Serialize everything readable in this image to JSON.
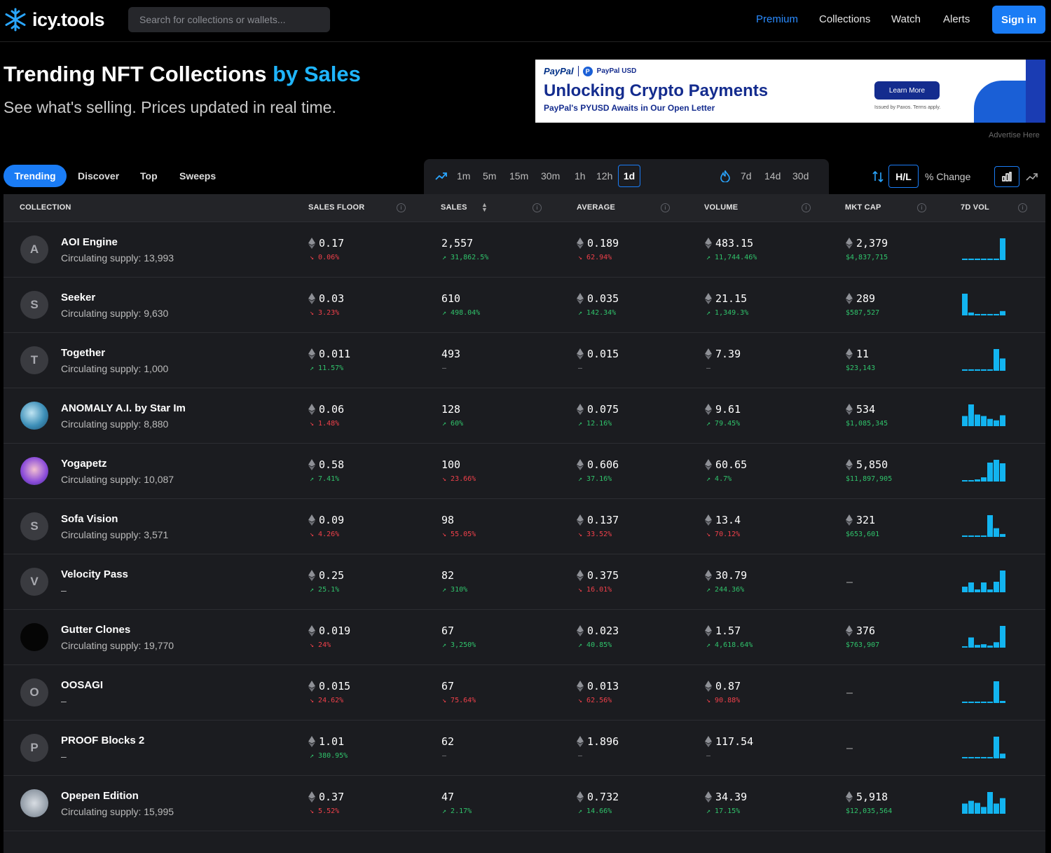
{
  "nav": {
    "brand": "icy.tools",
    "search_placeholder": "Search for collections or wallets...",
    "links": [
      "Premium",
      "Collections",
      "Watch",
      "Alerts"
    ],
    "signin": "Sign in",
    "accent": "#1a7cf5"
  },
  "hero": {
    "title": "Trending NFT Collections",
    "title_accent": "by Sales",
    "subtitle": "See what's selling. Prices updated in real time."
  },
  "ad": {
    "brand": "PayPal",
    "brand2": "PayPal USD",
    "headline": "Unlocking Crypto Payments",
    "sub": "PayPal's PYUSD Awaits in Our Open Letter",
    "button": "Learn More",
    "fine": "Issued by Paxos. Terms apply.",
    "advertise": "Advertise Here"
  },
  "tabs": [
    "Trending",
    "Discover",
    "Top",
    "Sweeps"
  ],
  "timeframes_short": [
    "1m",
    "5m",
    "15m",
    "30m",
    "1h",
    "12h",
    "1d"
  ],
  "timeframes_long": [
    "7d",
    "14d",
    "30d"
  ],
  "active_timeframe": "1d",
  "controls": {
    "hl": "H/L",
    "pct": "% Change"
  },
  "columns": [
    "COLLECTION",
    "SALES FLOOR",
    "SALES",
    "AVERAGE",
    "VOLUME",
    "MKT CAP",
    "7D VOL"
  ],
  "rows": [
    {
      "name": "AOI Engine",
      "supply": "Circulating supply: 13,993",
      "avatar": "A",
      "floor": "0.17",
      "floor_chg": "0.06%",
      "floor_dir": "down",
      "sales": "2,557",
      "sales_chg": "31,862.5%",
      "sales_dir": "up",
      "avg": "0.189",
      "avg_chg": "62.94%",
      "avg_dir": "down",
      "vol": "483.15",
      "vol_chg": "11,744.46%",
      "vol_dir": "up",
      "mcap": "2,379",
      "mcap_usd": "$4,837,715",
      "spark": [
        2,
        2,
        2,
        2,
        2,
        2,
        30
      ]
    },
    {
      "name": "Seeker",
      "supply": "Circulating supply: 9,630",
      "avatar": "S",
      "floor": "0.03",
      "floor_chg": "3.23%",
      "floor_dir": "down",
      "sales": "610",
      "sales_chg": "498.04%",
      "sales_dir": "up",
      "avg": "0.035",
      "avg_chg": "142.34%",
      "avg_dir": "up",
      "vol": "21.15",
      "vol_chg": "1,349.3%",
      "vol_dir": "up",
      "mcap": "289",
      "mcap_usd": "$587,527",
      "spark": [
        30,
        4,
        2,
        2,
        2,
        2,
        6
      ]
    },
    {
      "name": "Together",
      "supply": "Circulating supply: 1,000",
      "avatar": "T",
      "floor": "0.011",
      "floor_chg": "11.57%",
      "floor_dir": "up",
      "sales": "493",
      "sales_chg": "–",
      "sales_dir": "none",
      "avg": "0.015",
      "avg_chg": "–",
      "avg_dir": "none",
      "vol": "7.39",
      "vol_chg": "–",
      "vol_dir": "none",
      "mcap": "11",
      "mcap_usd": "$23,143",
      "spark": [
        2,
        2,
        2,
        2,
        2,
        30,
        17
      ]
    },
    {
      "name": "ANOMALY A.I. by Star Im",
      "supply": "Circulating supply: 8,880",
      "avatar": "",
      "floor": "0.06",
      "floor_chg": "1.48%",
      "floor_dir": "down",
      "sales": "128",
      "sales_chg": "60%",
      "sales_dir": "up",
      "avg": "0.075",
      "avg_chg": "12.16%",
      "avg_dir": "up",
      "vol": "9.61",
      "vol_chg": "79.45%",
      "vol_dir": "up",
      "mcap": "534",
      "mcap_usd": "$1,085,345",
      "spark": [
        14,
        30,
        16,
        14,
        10,
        8,
        15
      ]
    },
    {
      "name": "Yogapetz",
      "supply": "Circulating supply: 10,087",
      "avatar": "",
      "floor": "0.58",
      "floor_chg": "7.41%",
      "floor_dir": "up",
      "sales": "100",
      "sales_chg": "23.66%",
      "sales_dir": "down",
      "avg": "0.606",
      "avg_chg": "37.16%",
      "avg_dir": "up",
      "vol": "60.65",
      "vol_chg": "4.7%",
      "vol_dir": "up",
      "mcap": "5,850",
      "mcap_usd": "$11,897,905",
      "spark": [
        2,
        2,
        3,
        6,
        27,
        31,
        26
      ]
    },
    {
      "name": "Sofa Vision",
      "supply": "Circulating supply: 3,571",
      "avatar": "S",
      "floor": "0.09",
      "floor_chg": "4.26%",
      "floor_dir": "down",
      "sales": "98",
      "sales_chg": "55.05%",
      "sales_dir": "down",
      "avg": "0.137",
      "avg_chg": "33.52%",
      "avg_dir": "down",
      "vol": "13.4",
      "vol_chg": "70.12%",
      "vol_dir": "down",
      "mcap": "321",
      "mcap_usd": "$653,601",
      "spark": [
        2,
        2,
        2,
        2,
        30,
        12,
        4
      ]
    },
    {
      "name": "Velocity Pass",
      "supply": "–",
      "avatar": "V",
      "floor": "0.25",
      "floor_chg": "25.1%",
      "floor_dir": "up",
      "sales": "82",
      "sales_chg": "310%",
      "sales_dir": "up",
      "avg": "0.375",
      "avg_chg": "16.01%",
      "avg_dir": "down",
      "vol": "30.79",
      "vol_chg": "244.36%",
      "vol_dir": "up",
      "mcap": "–",
      "mcap_usd": "",
      "spark": [
        8,
        14,
        4,
        14,
        4,
        15,
        31
      ]
    },
    {
      "name": "Gutter Clones",
      "supply": "Circulating supply: 19,770",
      "avatar": "",
      "floor": "0.019",
      "floor_chg": "24%",
      "floor_dir": "down",
      "sales": "67",
      "sales_chg": "3,250%",
      "sales_dir": "up",
      "avg": "0.023",
      "avg_chg": "40.85%",
      "avg_dir": "up",
      "vol": "1.57",
      "vol_chg": "4,618.64%",
      "vol_dir": "up",
      "mcap": "376",
      "mcap_usd": "$763,907",
      "spark": [
        2,
        15,
        4,
        5,
        3,
        8,
        32
      ]
    },
    {
      "name": "OOSAGI",
      "supply": "–",
      "avatar": "O",
      "floor": "0.015",
      "floor_chg": "24.62%",
      "floor_dir": "down",
      "sales": "67",
      "sales_chg": "75.64%",
      "sales_dir": "down",
      "avg": "0.013",
      "avg_chg": "62.56%",
      "avg_dir": "down",
      "vol": "0.87",
      "vol_chg": "90.88%",
      "vol_dir": "down",
      "mcap": "–",
      "mcap_usd": "",
      "spark": [
        2,
        2,
        2,
        2,
        2,
        31,
        3
      ]
    },
    {
      "name": "PROOF Blocks 2",
      "supply": "–",
      "avatar": "P",
      "floor": "1.01",
      "floor_chg": "380.95%",
      "floor_dir": "up",
      "sales": "62",
      "sales_chg": "–",
      "sales_dir": "none",
      "avg": "1.896",
      "avg_chg": "–",
      "avg_dir": "none",
      "vol": "117.54",
      "vol_chg": "–",
      "vol_dir": "none",
      "mcap": "–",
      "mcap_usd": "",
      "spark": [
        2,
        2,
        2,
        2,
        2,
        32,
        7
      ]
    },
    {
      "name": "Opepen Edition",
      "supply": "Circulating supply: 15,995",
      "avatar": "",
      "floor": "0.37",
      "floor_chg": "5.52%",
      "floor_dir": "down",
      "sales": "47",
      "sales_chg": "2.17%",
      "sales_dir": "up",
      "avg": "0.732",
      "avg_chg": "14.66%",
      "avg_dir": "up",
      "vol": "34.39",
      "vol_chg": "17.15%",
      "vol_dir": "up",
      "mcap": "5,918",
      "mcap_usd": "$12,035,564",
      "spark": [
        15,
        19,
        16,
        10,
        32,
        15,
        23
      ]
    }
  ]
}
